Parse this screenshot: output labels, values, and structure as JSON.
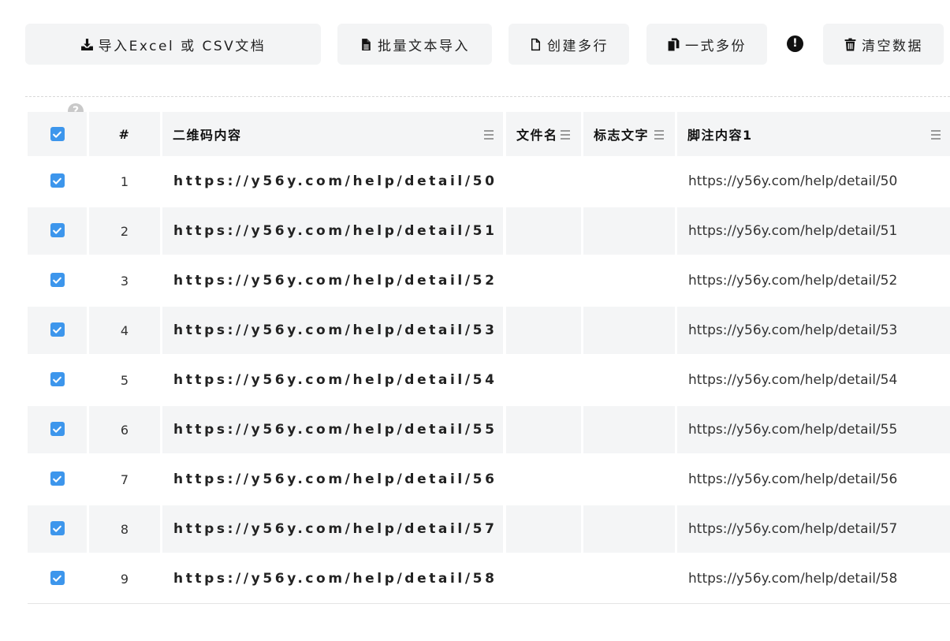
{
  "toolbar": {
    "import_excel_label": "导入Excel 或 CSV文档",
    "batch_text_import_label": "批量文本导入",
    "create_rows_label": "创建多行",
    "duplicate_label": "一式多份",
    "warning_symbol": "!",
    "clear_data_label": "清空数据"
  },
  "help_symbol": "?",
  "columns": {
    "index": "#",
    "qr_content": "二维码内容",
    "file_name": "文件名",
    "logo_text": "标志文字",
    "footer_content": "脚注内容1"
  },
  "rows": [
    {
      "checked": true,
      "index": "1",
      "qr_content": "https://y56y.com/help/detail/50",
      "file_name": "",
      "logo_text": "",
      "footer_content": "https://y56y.com/help/detail/50"
    },
    {
      "checked": true,
      "index": "2",
      "qr_content": "https://y56y.com/help/detail/51",
      "file_name": "",
      "logo_text": "",
      "footer_content": "https://y56y.com/help/detail/51"
    },
    {
      "checked": true,
      "index": "3",
      "qr_content": "https://y56y.com/help/detail/52",
      "file_name": "",
      "logo_text": "",
      "footer_content": "https://y56y.com/help/detail/52"
    },
    {
      "checked": true,
      "index": "4",
      "qr_content": "https://y56y.com/help/detail/53",
      "file_name": "",
      "logo_text": "",
      "footer_content": "https://y56y.com/help/detail/53"
    },
    {
      "checked": true,
      "index": "5",
      "qr_content": "https://y56y.com/help/detail/54",
      "file_name": "",
      "logo_text": "",
      "footer_content": "https://y56y.com/help/detail/54"
    },
    {
      "checked": true,
      "index": "6",
      "qr_content": "https://y56y.com/help/detail/55",
      "file_name": "",
      "logo_text": "",
      "footer_content": "https://y56y.com/help/detail/55"
    },
    {
      "checked": true,
      "index": "7",
      "qr_content": "https://y56y.com/help/detail/56",
      "file_name": "",
      "logo_text": "",
      "footer_content": "https://y56y.com/help/detail/56"
    },
    {
      "checked": true,
      "index": "8",
      "qr_content": "https://y56y.com/help/detail/57",
      "file_name": "",
      "logo_text": "",
      "footer_content": "https://y56y.com/help/detail/57"
    },
    {
      "checked": true,
      "index": "9",
      "qr_content": "https://y56y.com/help/detail/58",
      "file_name": "",
      "logo_text": "",
      "footer_content": "https://y56y.com/help/detail/58"
    }
  ],
  "colors": {
    "checkbox": "#3d96ec",
    "stripe": "#f4f5f6",
    "button_bg": "#f3f4f5"
  }
}
